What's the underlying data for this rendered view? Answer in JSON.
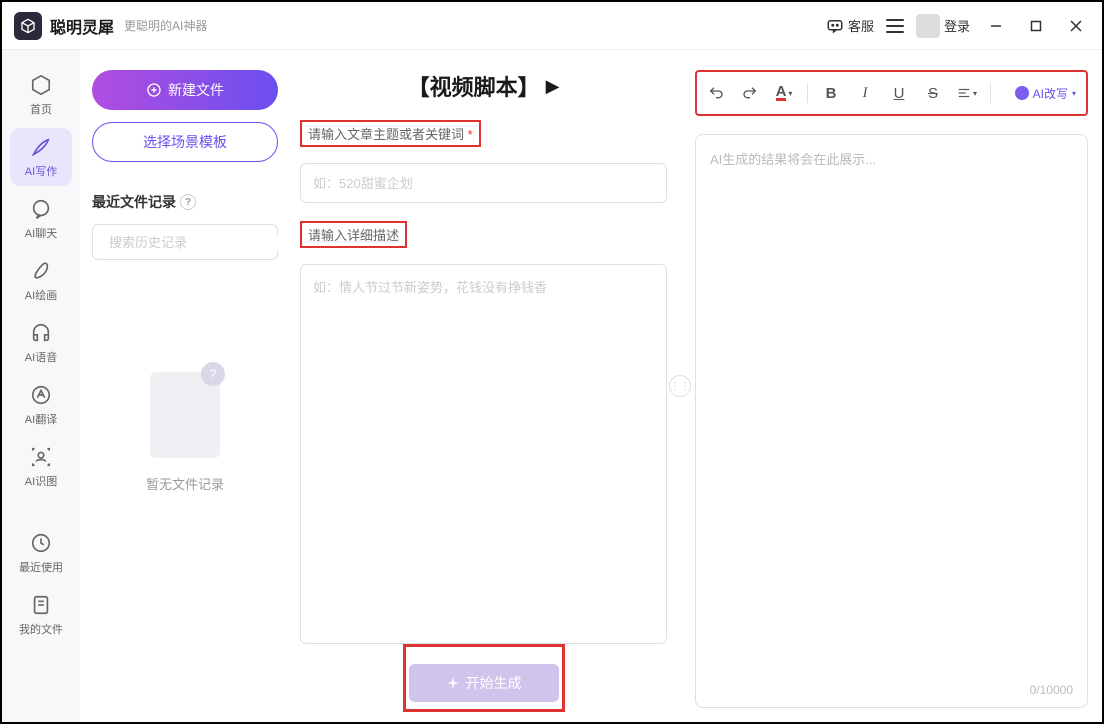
{
  "titlebar": {
    "app_name": "聪明灵犀",
    "app_subtitle": "更聪明的AI神器",
    "kefu_label": "客服",
    "login_label": "登录"
  },
  "sidebar": {
    "items": [
      {
        "label": "首页"
      },
      {
        "label": "AI写作"
      },
      {
        "label": "AI聊天"
      },
      {
        "label": "AI绘画"
      },
      {
        "label": "AI语音"
      },
      {
        "label": "AI翻译"
      },
      {
        "label": "AI识图"
      },
      {
        "label": "最近使用"
      },
      {
        "label": "我的文件"
      }
    ]
  },
  "left_panel": {
    "new_file": "新建文件",
    "template": "选择场景模板",
    "recent_label": "最近文件记录",
    "search_placeholder": "搜索历史记录",
    "empty_text": "暂无文件记录"
  },
  "mid_panel": {
    "title": "【视频脚本】",
    "field1_label": "请输入文章主题或者关键词",
    "field1_placeholder": "如：520甜蜜企划",
    "field2_label": "请输入详细描述",
    "field2_placeholder": "如：情人节过节新姿势，花钱没有挣钱香",
    "generate_btn": "开始生成"
  },
  "right_panel": {
    "ai_rewrite": "AI改写",
    "output_placeholder": "AI生成的结果将会在此展示...",
    "char_count": "0/10000"
  }
}
